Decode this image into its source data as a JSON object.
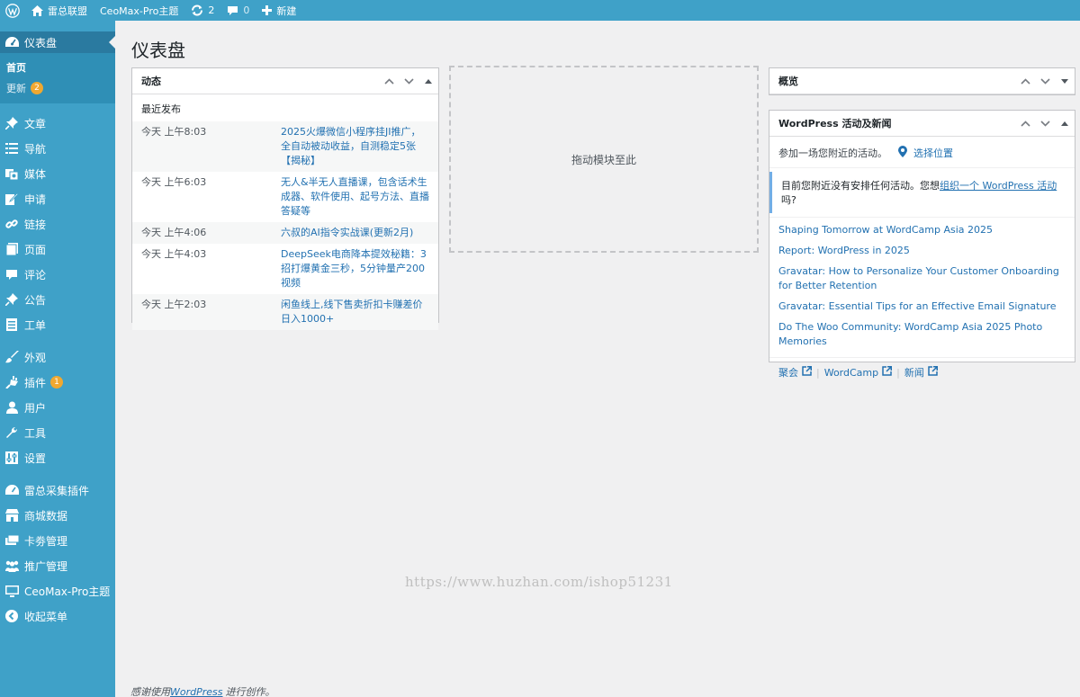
{
  "adminbar": {
    "site_name": "雷总联盟",
    "theme_name": "CeoMax-Pro主题",
    "updates_count": "2",
    "comments_count": "0",
    "new_label": "新建"
  },
  "sidebar": {
    "dashboard": "仪表盘",
    "submenu": {
      "home": "首页",
      "updates": "更新",
      "updates_badge": "2"
    },
    "items": [
      {
        "label": "文章",
        "icon": "pushpin-icon"
      },
      {
        "label": "导航",
        "icon": "list-icon"
      },
      {
        "label": "媒体",
        "icon": "media-icon"
      },
      {
        "label": "申请",
        "icon": "edit-icon"
      },
      {
        "label": "链接",
        "icon": "link-icon"
      },
      {
        "label": "页面",
        "icon": "page-icon"
      },
      {
        "label": "评论",
        "icon": "comment-icon"
      },
      {
        "label": "公告",
        "icon": "pushpin-icon"
      },
      {
        "label": "工单",
        "icon": "form-icon"
      },
      {
        "label": "外观",
        "icon": "brush-icon"
      },
      {
        "label": "插件",
        "icon": "plugin-icon",
        "badge": "1"
      },
      {
        "label": "用户",
        "icon": "user-icon"
      },
      {
        "label": "工具",
        "icon": "wrench-icon"
      },
      {
        "label": "设置",
        "icon": "settings-icon"
      },
      {
        "label": "雷总采集插件",
        "icon": "gauge-icon"
      },
      {
        "label": "商城数据",
        "icon": "store-icon"
      },
      {
        "label": "卡劵管理",
        "icon": "cards-icon"
      },
      {
        "label": "推广管理",
        "icon": "groups-icon"
      },
      {
        "label": "CeoMax-Pro主题",
        "icon": "desktop-icon"
      },
      {
        "label": "收起菜单",
        "icon": "collapse-icon"
      }
    ]
  },
  "page": {
    "title": "仪表盘"
  },
  "activity": {
    "title": "动态",
    "subheading": "最近发布",
    "rows": [
      {
        "time": "今天 上午8:03",
        "title": "2025火爆微信小程序挂JI推广，全自动被动收益，自测稳定5张【揭秘】"
      },
      {
        "time": "今天 上午6:03",
        "title": "无人&半无人直播课，包含话术生成器、软件使用、起号方法、直播答疑等"
      },
      {
        "time": "今天 上午4:06",
        "title": "六叔的AI指令实战课(更新2月)"
      },
      {
        "time": "今天 上午4:03",
        "title": "DeepSeek电商降本提效秘籍：3招打爆黄金三秒，5分钟量产200视频"
      },
      {
        "time": "今天 上午2:03",
        "title": "闲鱼线上,线下售卖折扣卡赚差价日入1000+"
      }
    ]
  },
  "dropzone": {
    "label": "拖动模块至此"
  },
  "overview": {
    "title": "概览"
  },
  "news": {
    "title": "WordPress 活动及新闻",
    "invite": "参加一场您附近的活动。",
    "select_location": "选择位置",
    "notice_prefix": "目前您附近没有安排任何活动。您想",
    "notice_link": "组织一个 WordPress 活动",
    "notice_suffix": "吗?",
    "items": [
      "Shaping Tomorrow at WordCamp Asia 2025",
      "Report: WordPress in 2025",
      "Gravatar: How to Personalize Your Customer Onboarding for Better Retention",
      "Gravatar: Essential Tips for an Effective Email Signature",
      "Do The Woo Community: WordCamp Asia 2025 Photo Memories"
    ],
    "footer": {
      "meetups": "聚会",
      "wordcamp": "WordCamp",
      "news": "新闻"
    }
  },
  "footer": {
    "prefix": "感谢使用",
    "link": "WordPress",
    "suffix": "进行创作。"
  },
  "watermark": "https://www.huzhan.com/ishop51231",
  "colors": {
    "sidebar": "#3fa1c8",
    "current": "#2a7aa0",
    "link": "#2271b1",
    "badge": "#f0a830"
  }
}
